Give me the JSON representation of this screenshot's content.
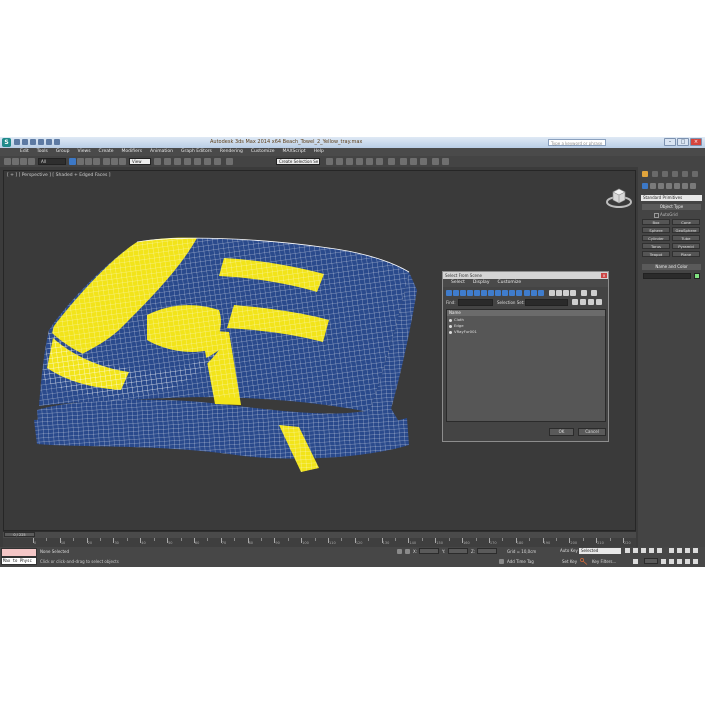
{
  "title_bar": {
    "app_logo": "S",
    "window_title": "Autodesk 3ds Max 2014 x64    Beach_Towel_2_Yellow_tray.max",
    "search_placeholder": "Type a keyword or phrase",
    "controls": [
      "–",
      "□",
      "×"
    ]
  },
  "menu": [
    "Edit",
    "Tools",
    "Group",
    "Views",
    "Create",
    "Modifiers",
    "Animation",
    "Graph Editors",
    "Rendering",
    "Customize",
    "MAXScript",
    "Help"
  ],
  "main_toolbar": {
    "filter_value": "All",
    "ref_coord_value": "View",
    "named_selection_value": "Create Selection Se"
  },
  "viewport": {
    "label": "[ + ] [ Perspective ] [ Shaded + Edged Faces ]"
  },
  "dialog": {
    "title": "Select From Scene",
    "close": "×",
    "menu": [
      "Select",
      "Display",
      "Customize"
    ],
    "find_label": "Find:",
    "selection_set_label": "Selection Set:",
    "column_header": "Name",
    "objects": [
      "Cloth",
      "Edge",
      "VRayFur001"
    ],
    "ok": "OK",
    "cancel": "Cancel"
  },
  "command_panel": {
    "dropdown": "Standard Primitives",
    "object_type_header": "Object Type",
    "autogrid": "AutoGrid",
    "primitives": [
      "Box",
      "Cone",
      "Sphere",
      "GeoSphere",
      "Cylinder",
      "Tube",
      "Torus",
      "Pyramid",
      "Teapot",
      "Plane"
    ],
    "name_color_header": "Name and Color",
    "swatch_color": "#7fe27f"
  },
  "timeline": {
    "slider_label": "0 / 225",
    "ticks": [
      "0",
      "10",
      "20",
      "30",
      "40",
      "50",
      "60",
      "70",
      "80",
      "90",
      "100",
      "110",
      "120",
      "130",
      "140",
      "150",
      "160",
      "170",
      "180",
      "190",
      "200",
      "210",
      "220"
    ]
  },
  "status": {
    "maxscript_line": "Max to Physc",
    "selection": "None Selected",
    "prompt": "Click or click-and-drag to select objects",
    "x_label": "X:",
    "y_label": "Y:",
    "z_label": "Z:",
    "grid": "Grid = 10,0cm",
    "add_time_tag": "Add Time Tag",
    "auto_key": "Auto Key",
    "set_key": "Set Key",
    "selected_mode": "Selected",
    "key_filters": "Key Filters...",
    "frame_value": "0"
  },
  "colors": {
    "towel_yellow": "#f2e41a",
    "towel_blue": "#2a4a8c",
    "viewport_bg": "#3a3a3a",
    "accent_blue": "#3c78c6"
  }
}
